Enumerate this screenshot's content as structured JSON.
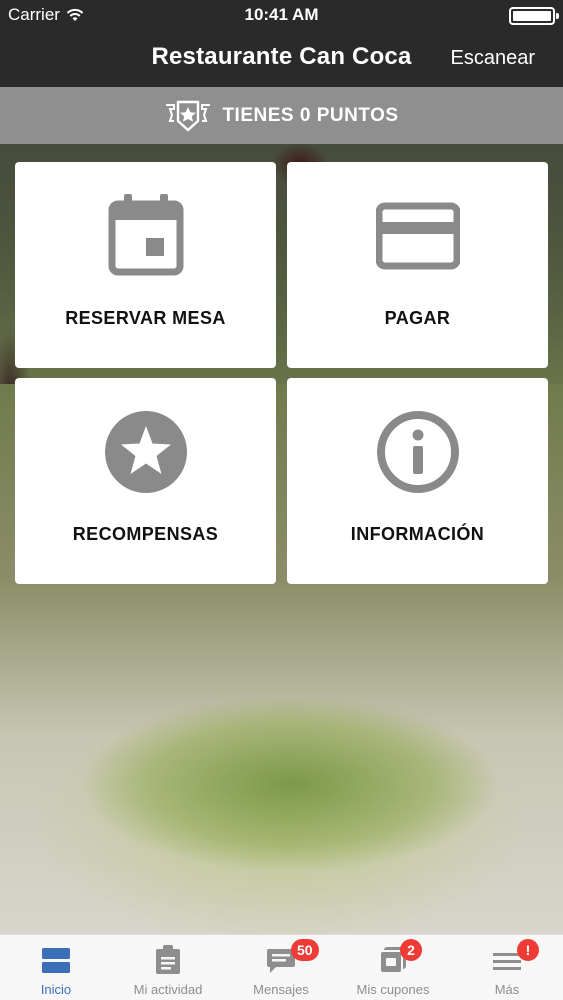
{
  "status_bar": {
    "carrier": "Carrier",
    "time": "10:41 AM"
  },
  "nav": {
    "title": "Restaurante Can Coca",
    "scan_label": "Escanear"
  },
  "points": {
    "label": "TIENES 0 PUNTOS",
    "icon": "badge-star-icon"
  },
  "tiles": [
    {
      "label": "RESERVAR MESA",
      "icon": "calendar-icon"
    },
    {
      "label": "PAGAR",
      "icon": "credit-card-icon"
    },
    {
      "label": "RECOMPENSAS",
      "icon": "star-icon"
    },
    {
      "label": "INFORMACIÓN",
      "icon": "info-icon"
    }
  ],
  "tabs": [
    {
      "label": "Inicio",
      "icon": "home-icon",
      "active": true
    },
    {
      "label": "Mi actividad",
      "icon": "clipboard-icon"
    },
    {
      "label": "Mensajes",
      "icon": "chat-icon",
      "badge": "50"
    },
    {
      "label": "Mis cupones",
      "icon": "coupon-icon",
      "badge": "2"
    },
    {
      "label": "Más",
      "icon": "menu-icon",
      "badge": "!"
    }
  ],
  "colors": {
    "header_bg": "#2a2a2a",
    "points_bg": "#969696",
    "icon_gray": "#8a8a8a",
    "active_tab": "#3a6fb8",
    "badge_red": "#ef3b36"
  }
}
